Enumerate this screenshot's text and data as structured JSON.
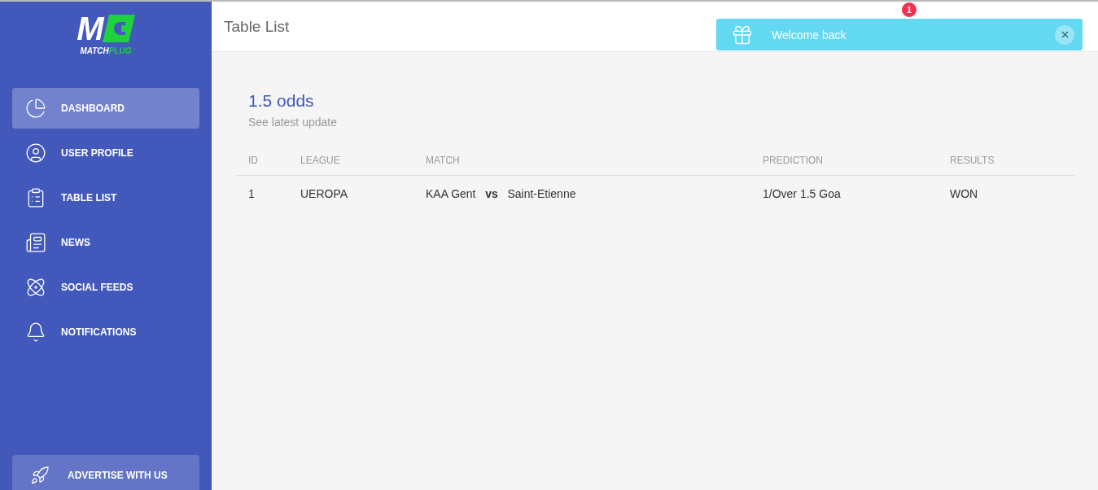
{
  "logo": {
    "mark": "M",
    "name_left": "MATCH",
    "name_right": "PLUG"
  },
  "sidebar": {
    "items": [
      {
        "label": "DASHBOARD",
        "selected": true
      },
      {
        "label": "USER PROFILE",
        "selected": false
      },
      {
        "label": "TABLE LIST",
        "selected": false
      },
      {
        "label": "NEWS",
        "selected": false
      },
      {
        "label": "SOCIAL FEEDS",
        "selected": false
      },
      {
        "label": "NOTIFICATIONS",
        "selected": false
      }
    ],
    "bottom_button": {
      "label": "ADVERTISE WITH US"
    }
  },
  "header": {
    "title": "Table List",
    "notification_badge": "1"
  },
  "toast": {
    "message": "Welcome back"
  },
  "card": {
    "title": "1.5 odds",
    "subtitle": "See latest update"
  },
  "table": {
    "columns": [
      "ID",
      "LEAGUE",
      "MATCH",
      "PREDICTION",
      "RESULTS"
    ],
    "rows": [
      [
        "1",
        "UEROPA",
        "KAA Gent   **vs**   Saint-Etienne",
        "1/Over 1.5 Goa",
        "WON"
      ]
    ]
  }
}
